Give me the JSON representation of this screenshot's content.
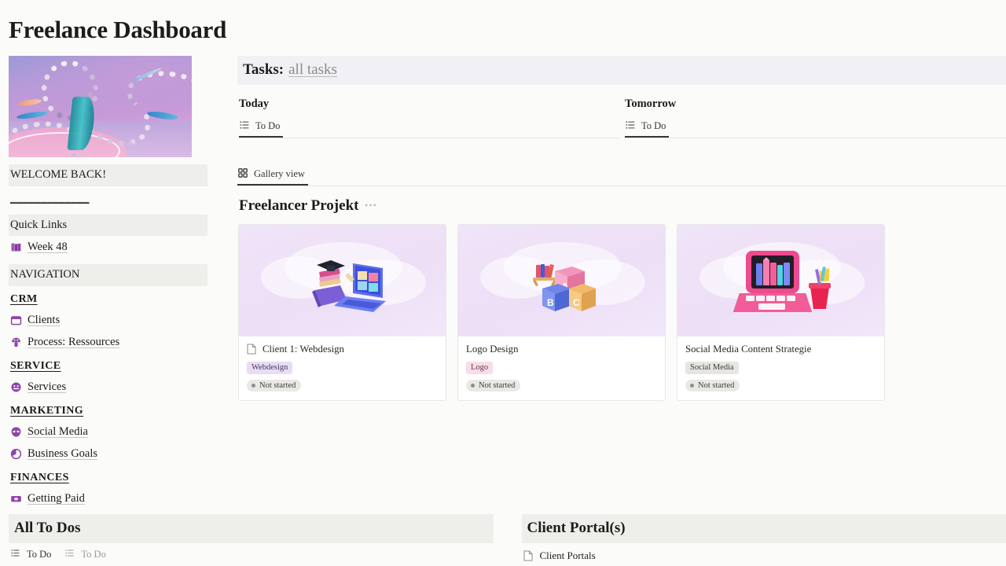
{
  "page": {
    "title": "Freelance Dashboard"
  },
  "sidebar": {
    "hero_icon": "abstract-3d-chain-render",
    "welcome_label": "WELCOME BACK!",
    "divider_label": "_____________",
    "quick_links_label": "Quick Links",
    "quick_links": [
      {
        "icon": "books-icon",
        "label": "Week 48"
      }
    ],
    "navigation_label": "NAVIGATION",
    "sections": [
      {
        "heading": "CRM",
        "items": [
          {
            "icon": "calendar-icon",
            "label": "Clients"
          },
          {
            "icon": "mushroom-icon",
            "label": "Process: Ressources"
          }
        ]
      },
      {
        "heading": "SERVICE",
        "items": [
          {
            "icon": "smiley-face-icon",
            "label": "Services"
          }
        ]
      },
      {
        "heading": "MARKETING",
        "items": [
          {
            "icon": "alien-face-icon",
            "label": "Social Media"
          },
          {
            "icon": "pie-chart-icon",
            "label": "Business Goals"
          }
        ]
      },
      {
        "heading": "FINANCES",
        "items": [
          {
            "icon": "money-bill-icon",
            "label": "Getting Paid"
          }
        ]
      }
    ]
  },
  "tasks": {
    "heading_strong": "Tasks:",
    "heading_muted": "all tasks",
    "columns": [
      {
        "title": "Today",
        "tabs": [
          {
            "icon": "list-icon",
            "label": "To Do",
            "active": true
          }
        ]
      },
      {
        "title": "Tomorrow",
        "tabs": [
          {
            "icon": "list-icon",
            "label": "To Do",
            "active": true
          }
        ]
      }
    ]
  },
  "gallery": {
    "view_tab": {
      "icon": "grid-icon",
      "label": "Gallery view"
    },
    "title": "Freelancer Projekt",
    "more_icon": "ellipsis-icon",
    "cards": [
      {
        "thumb_icon": "laptop-graduation-cap-books-illustration",
        "has_page_icon": true,
        "page_icon": "page-icon",
        "title": "Client 1: Webdesign",
        "tag": "Webdesign",
        "tag_color": "purple",
        "status": "Not started"
      },
      {
        "thumb_icon": "abc-blocks-bookshelf-illustration",
        "has_page_icon": false,
        "page_icon": "",
        "title": "Logo Design",
        "tag": "Logo",
        "tag_color": "pink",
        "status": "Not started"
      },
      {
        "thumb_icon": "pink-laptop-books-pencil-cup-illustration",
        "has_page_icon": false,
        "page_icon": "",
        "title": "Social Media Content Strategie",
        "tag": "Social Media",
        "tag_color": "grey",
        "status": "Not started"
      }
    ]
  },
  "bottom": {
    "todos": {
      "title": "All To Dos",
      "tabs": [
        {
          "icon": "list-icon",
          "label": "To Do",
          "active": true
        },
        {
          "icon": "list-icon",
          "label": "To Do",
          "active": false
        }
      ]
    },
    "portals": {
      "title": "Client Portal(s)",
      "link": {
        "icon": "page-icon",
        "label": "Client Portals"
      }
    }
  },
  "colors": {
    "page_bg": "#fbfbfa",
    "band_grey": "#eeeeea",
    "band_lavender": "#f1f0f5",
    "icon_purple": "#8b4ea8",
    "thumb_bg": "#efe3f8"
  }
}
